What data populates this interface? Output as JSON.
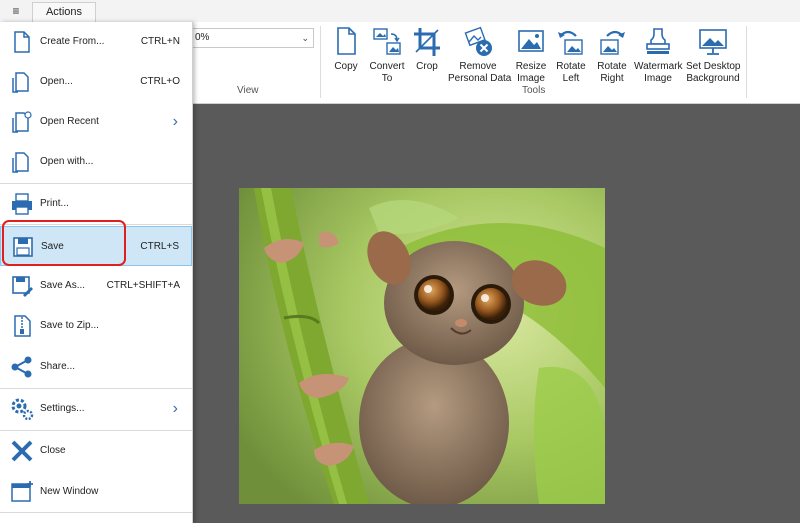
{
  "tabs": {
    "menu_glyph": "≡",
    "actions": "Actions"
  },
  "zoom": {
    "value": "0%"
  },
  "ribbon": {
    "view_label": "View",
    "tools_label": "Tools",
    "buttons": [
      {
        "label": "Copy",
        "icon": "copy-icon"
      },
      {
        "label": "Convert\nTo",
        "icon": "convert-icon"
      },
      {
        "label": "Crop",
        "icon": "crop-icon"
      },
      {
        "label": "Remove\nPersonal Data",
        "icon": "remove-personal-data-icon"
      },
      {
        "label": "Resize\nImage",
        "icon": "resize-icon"
      },
      {
        "label": "Rotate\nLeft",
        "icon": "rotate-left-icon"
      },
      {
        "label": "Rotate\nRight",
        "icon": "rotate-right-icon"
      },
      {
        "label": "Watermark\nImage",
        "icon": "watermark-icon"
      },
      {
        "label": "Set Desktop\nBackground",
        "icon": "desktop-background-icon"
      }
    ]
  },
  "filemenu": {
    "items": [
      {
        "label": "Create From...",
        "shortcut": "CTRL+N"
      },
      {
        "label": "Open...",
        "shortcut": "CTRL+O"
      },
      {
        "label": "Open Recent",
        "shortcut": ""
      },
      {
        "label": "Open with...",
        "shortcut": ""
      },
      {
        "label": "Print...",
        "shortcut": ""
      },
      {
        "label": "Save",
        "shortcut": "CTRL+S"
      },
      {
        "label": "Save As...",
        "shortcut": "CTRL+SHIFT+A"
      },
      {
        "label": "Save to Zip...",
        "shortcut": ""
      },
      {
        "label": "Share...",
        "shortcut": ""
      },
      {
        "label": "Settings...",
        "shortcut": ""
      },
      {
        "label": "Close",
        "shortcut": ""
      },
      {
        "label": "New Window",
        "shortcut": ""
      }
    ]
  },
  "colors": {
    "accent": "#2b6cb0",
    "selected_bg": "#cfe6f6",
    "highlight_ring": "#e02020",
    "canvas_bg": "#5a5a5a"
  }
}
